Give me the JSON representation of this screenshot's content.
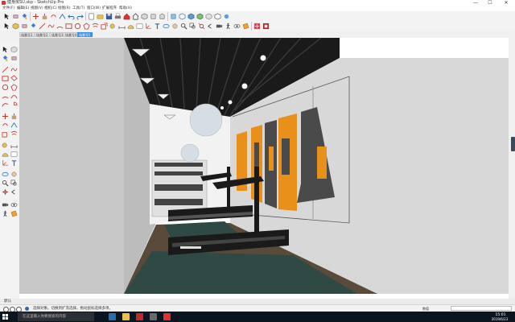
{
  "window": {
    "title": "健身房SU.skp - SketchUp Pro",
    "minimize_glyph": "—",
    "maximize_glyph": "☐",
    "close_glyph": "✕"
  },
  "menubar": {
    "items": [
      "文件(F)",
      "编辑(E)",
      "视图(V)",
      "相机(C)",
      "绘图(R)",
      "工具(T)",
      "窗口(W)",
      "扩展程序",
      "帮助(H)"
    ]
  },
  "scene_tabs": [
    "场景号1",
    "场景号2",
    "场景号3",
    "场景号4",
    "场景号5"
  ],
  "status": {
    "tray_label": "默认",
    "message": "选择对象。切换到扩充选择。拖动鼠标选择多项。",
    "measure_label": "数值"
  },
  "taskbar": {
    "search_placeholder": "在这里输入你要搜索的内容",
    "time": "15:01",
    "date": "2019/6/23"
  },
  "colors": {
    "accent": "#3a8ee6",
    "poster_orange": "#e8901a",
    "poster_gray": "#4a4a4a",
    "floor_green": "#2f4a45",
    "floor_wood": "#5a4a3a",
    "wall": "#d8d8d8",
    "ceiling": "#1a1a1a",
    "taskbar": "#0b1520"
  }
}
